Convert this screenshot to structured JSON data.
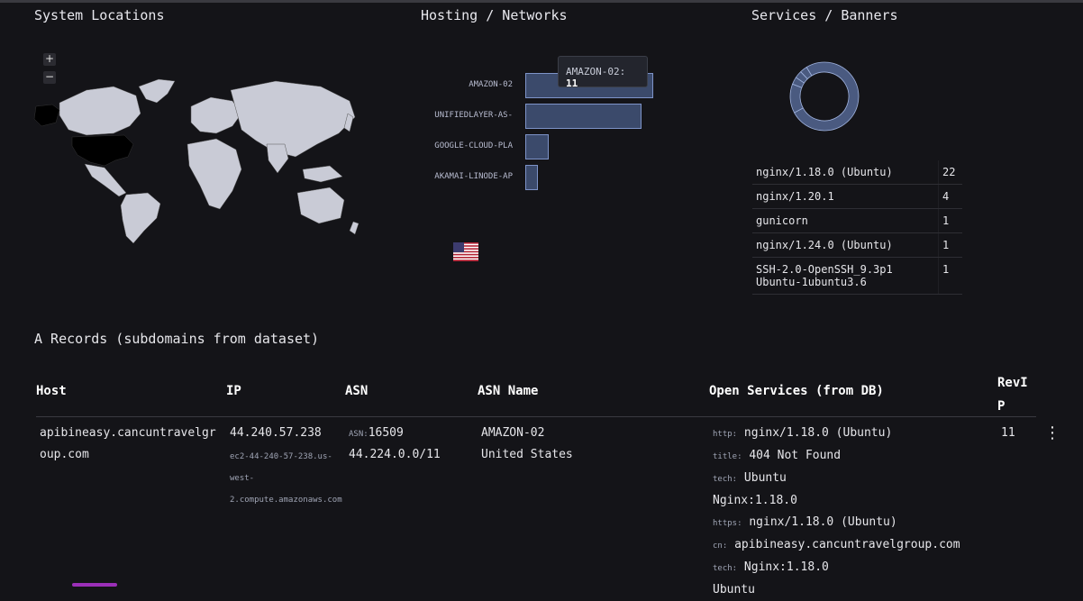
{
  "sections": {
    "system_locations": "System Locations",
    "hosting_networks": "Hosting / Networks",
    "services_banners": "Services / Banners",
    "a_records": "A Records (subdomains from dataset)"
  },
  "map": {
    "zoom_in": "+",
    "zoom_out": "−",
    "highlight_color": "#000000",
    "land_color": "#c9cbd6"
  },
  "hosting": {
    "tooltip_label": "AMAZON-02:",
    "tooltip_value": "11",
    "bars": [
      {
        "label": "AMAZON-02",
        "value": 11
      },
      {
        "label": "UNIFIEDLAYER-AS-",
        "value": 10
      },
      {
        "label": "GOOGLE-CLOUD-PLA",
        "value": 2
      },
      {
        "label": "AKAMAI-LINODE-AP",
        "value": 1
      }
    ],
    "flag_icon": "us-flag-icon"
  },
  "chart_data": {
    "type": "bar",
    "categories": [
      "AMAZON-02",
      "UNIFIEDLAYER-AS-",
      "GOOGLE-CLOUD-PLA",
      "AKAMAI-LINODE-AP"
    ],
    "values": [
      11,
      10,
      2,
      1
    ]
  },
  "services": [
    {
      "name": "nginx/1.18.0 (Ubuntu)",
      "count": "22"
    },
    {
      "name": "nginx/1.20.1",
      "count": "4"
    },
    {
      "name": "gunicorn",
      "count": "1"
    },
    {
      "name": "nginx/1.24.0 (Ubuntu)",
      "count": "1"
    },
    {
      "name": "SSH-2.0-OpenSSH_9.3p1 Ubuntu-1ubuntu3.6",
      "count": "1"
    }
  ],
  "donut": {
    "slices": [
      22,
      4,
      1,
      1,
      1
    ],
    "colors": [
      "#4a5a80",
      "#4a5a80",
      "#4a5a80",
      "#4a5a80",
      "#4a5a80"
    ]
  },
  "table": {
    "headers": {
      "host": "Host",
      "ip": "IP",
      "asn": "ASN",
      "asn_name": "ASN Name",
      "open_services": "Open Services (from DB)",
      "revip": "RevIP"
    },
    "row": {
      "host": "apibineasy.cancuntravelgroup.com",
      "ip": "44.240.57.238",
      "rdns": "ec2-44-240-57-238.us-west-2.compute.amazonaws.com",
      "asn_prefix": "ASN:",
      "asn": "16509",
      "cidr": "44.224.0.0/11",
      "asn_name": "AMAZON-02",
      "country": "United States",
      "revip": "11",
      "services": [
        {
          "key": "http:",
          "val": "nginx/1.18.0 (Ubuntu)"
        },
        {
          "key": "title:",
          "val": "404 Not Found"
        },
        {
          "key": "tech:",
          "val": "Ubuntu"
        },
        {
          "key": "",
          "val": "Nginx:1.18.0"
        },
        {
          "key": "https:",
          "val": "nginx/1.18.0 (Ubuntu)"
        },
        {
          "key": "cn:",
          "val": "apibineasy.cancuntravelgroup.com"
        },
        {
          "key": "tech:",
          "val": "Nginx:1.18.0"
        },
        {
          "key": "",
          "val": "Ubuntu"
        }
      ]
    },
    "kebab": "⋮"
  }
}
